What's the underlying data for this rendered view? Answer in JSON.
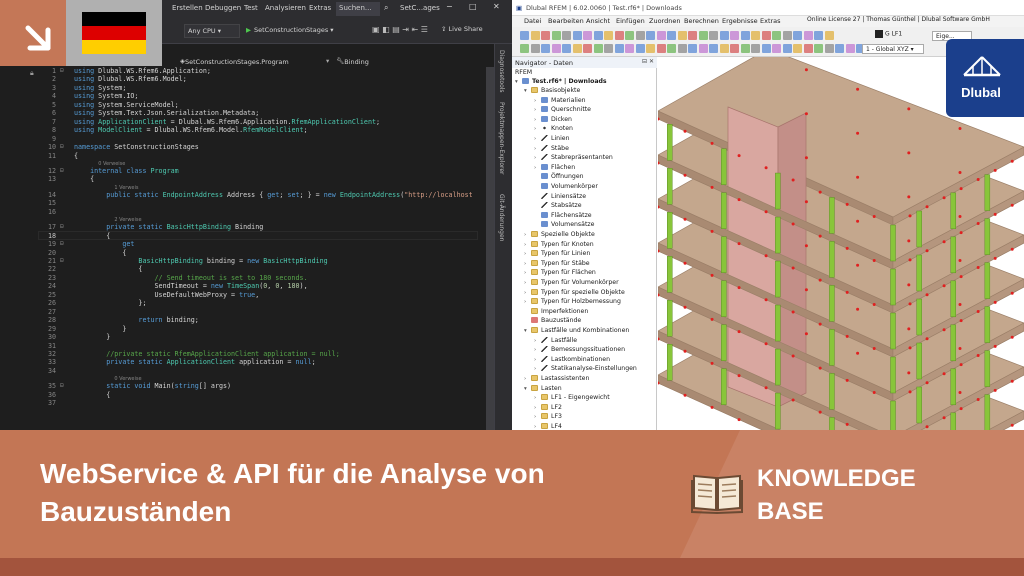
{
  "vs": {
    "menu": [
      "Erstellen",
      "Debuggen",
      "Test",
      "Analysieren",
      "Extras"
    ],
    "search": "Suchen...",
    "solution": "SetC...ages",
    "toolbar": {
      "config": "",
      "platform": "Any CPU",
      "run_target": "SetConstructionStages",
      "live_share": "Live Share"
    },
    "nav": {
      "type": "SetConstructionStages.Program",
      "member": "Binding"
    },
    "side_tabs": [
      "Diagnosetools",
      "Projektmappen-Explorer",
      "Git-Änderungen"
    ],
    "code_lines": [
      {
        "n": "1",
        "tokens": [
          [
            "k",
            "using "
          ],
          [
            "",
            "Dlubal.WS.Rfem6.Application;"
          ]
        ]
      },
      {
        "n": "2",
        "tokens": [
          [
            "k",
            "using "
          ],
          [
            "",
            "Dlubal.WS.Rfem6.Model;"
          ]
        ]
      },
      {
        "n": "3",
        "tokens": [
          [
            "k",
            "using "
          ],
          [
            "",
            "System;"
          ]
        ]
      },
      {
        "n": "4",
        "tokens": [
          [
            "k",
            "using "
          ],
          [
            "",
            "System.IO;"
          ]
        ]
      },
      {
        "n": "5",
        "tokens": [
          [
            "k",
            "using "
          ],
          [
            "",
            "System.ServiceModel;"
          ]
        ]
      },
      {
        "n": "6",
        "tokens": [
          [
            "k",
            "using "
          ],
          [
            "",
            "System.Text.Json.Serialization.Metadata;"
          ]
        ]
      },
      {
        "n": "7",
        "tokens": [
          [
            "k",
            "using "
          ],
          [
            "t",
            "ApplicationClient"
          ],
          [
            "",
            " = Dlubal.WS.Rfem6.Application."
          ],
          [
            "t",
            "RfemApplicationClient"
          ],
          [
            "",
            ";"
          ]
        ]
      },
      {
        "n": "8",
        "tokens": [
          [
            "k",
            "using "
          ],
          [
            "t",
            "ModelClient"
          ],
          [
            "",
            " = Dlubal.WS.Rfem6.Model."
          ],
          [
            "t",
            "RfemModelClient"
          ],
          [
            "",
            ";"
          ]
        ]
      },
      {
        "n": "9",
        "tokens": []
      },
      {
        "n": "10",
        "tokens": [
          [
            "k",
            "namespace "
          ],
          [
            "",
            "SetConstructionStages"
          ]
        ]
      },
      {
        "n": "11",
        "tokens": [
          [
            "",
            "{"
          ]
        ]
      },
      {
        "n": "12",
        "tokens": [
          [
            "k",
            "    internal class "
          ],
          [
            "t",
            "Program"
          ]
        ]
      },
      {
        "n": "13",
        "tokens": [
          [
            "",
            "    {"
          ]
        ]
      },
      {
        "n": "14",
        "tokens": [
          [
            "k",
            "        public static "
          ],
          [
            "t",
            "EndpointAddress"
          ],
          [
            "",
            " Address { "
          ],
          [
            "k",
            "get"
          ],
          [
            "",
            "; "
          ],
          [
            "k",
            "set"
          ],
          [
            "",
            "; } = "
          ],
          [
            "k",
            "new "
          ],
          [
            "t",
            "EndpointAddress"
          ],
          [
            "",
            "("
          ],
          [
            "s",
            "\"http://localhost"
          ]
        ]
      },
      {
        "n": "15",
        "tokens": []
      },
      {
        "n": "16",
        "tokens": []
      },
      {
        "n": "17",
        "tokens": [
          [
            "k",
            "        private static "
          ],
          [
            "t",
            "BasicHttpBinding"
          ],
          [
            "",
            " Binding"
          ]
        ]
      },
      {
        "n": "18",
        "tokens": [
          [
            "",
            "        {"
          ]
        ]
      },
      {
        "n": "19",
        "tokens": [
          [
            "k",
            "            get"
          ]
        ]
      },
      {
        "n": "20",
        "tokens": [
          [
            "",
            "            {"
          ]
        ]
      },
      {
        "n": "21",
        "tokens": [
          [
            "t",
            "                BasicHttpBinding"
          ],
          [
            "",
            " binding = "
          ],
          [
            "k",
            "new "
          ],
          [
            "t",
            "BasicHttpBinding"
          ]
        ]
      },
      {
        "n": "22",
        "tokens": [
          [
            "",
            "                {"
          ]
        ]
      },
      {
        "n": "23",
        "tokens": [
          [
            "c",
            "                    // Send timeout is set to 180 seconds."
          ]
        ]
      },
      {
        "n": "24",
        "tokens": [
          [
            "",
            "                    SendTimeout = "
          ],
          [
            "k",
            "new "
          ],
          [
            "t",
            "TimeSpan"
          ],
          [
            "",
            "("
          ],
          [
            "n",
            "0"
          ],
          [
            "",
            ", "
          ],
          [
            "n",
            "0"
          ],
          [
            "",
            ", "
          ],
          [
            "n",
            "180"
          ],
          [
            "",
            "),"
          ]
        ]
      },
      {
        "n": "25",
        "tokens": [
          [
            "",
            "                    UseDefaultWebProxy = "
          ],
          [
            "k",
            "true"
          ],
          [
            "",
            ","
          ]
        ]
      },
      {
        "n": "26",
        "tokens": [
          [
            "",
            "                };"
          ]
        ]
      },
      {
        "n": "27",
        "tokens": []
      },
      {
        "n": "28",
        "tokens": [
          [
            "k",
            "                return "
          ],
          [
            "",
            "binding;"
          ]
        ]
      },
      {
        "n": "29",
        "tokens": [
          [
            "",
            "            }"
          ]
        ]
      },
      {
        "n": "30",
        "tokens": [
          [
            "",
            "        }"
          ]
        ]
      },
      {
        "n": "31",
        "tokens": []
      },
      {
        "n": "32",
        "tokens": [
          [
            "c",
            "        //private static RfemApplicationClient application = null;"
          ]
        ]
      },
      {
        "n": "33",
        "tokens": [
          [
            "k",
            "        private static "
          ],
          [
            "t",
            "ApplicationClient"
          ],
          [
            "",
            " application = "
          ],
          [
            "k",
            "null"
          ],
          [
            "",
            ";"
          ]
        ]
      },
      {
        "n": "34",
        "tokens": []
      },
      {
        "n": "35",
        "tokens": [
          [
            "k",
            "        static void "
          ],
          [
            "",
            "Main("
          ],
          [
            "k",
            "string"
          ],
          [
            "",
            "[] args)"
          ]
        ]
      },
      {
        "n": "36",
        "tokens": [
          [
            "",
            "        {"
          ]
        ]
      },
      {
        "n": "37",
        "tokens": []
      }
    ],
    "hints": [
      {
        "before": "12",
        "text": "0 Verweise"
      },
      {
        "before": "14",
        "text": "1 Verweis"
      },
      {
        "before": "17",
        "text": "2 Verweise"
      },
      {
        "before": "35",
        "text": "0 Verweise"
      }
    ]
  },
  "rfem": {
    "title": "Dlubal RFEM | 6.02.0060 | Test.rf6* | Downloads",
    "menu": [
      "Datei",
      "Bearbeiten",
      "Ansicht",
      "Einfügen",
      "Zuordnen",
      "Berechnen",
      "Ergebnisse",
      "Extras"
    ],
    "license": "Online License 27 | Thomas Günthel | Dlubal Software GmbH",
    "load_case": "G",
    "load_case_id": "LF1",
    "eigen": "Eige...",
    "view": "1 - Global XYZ",
    "navigator": {
      "header": "Navigator - Daten",
      "root": "RFEM",
      "file": "Test.rf6* | Downloads",
      "items": [
        {
          "level": 1,
          "arrow": "down",
          "icon": "fold-i",
          "label": "Basisobjekte"
        },
        {
          "level": 2,
          "arrow": "right",
          "icon": "blue",
          "label": "Materialien"
        },
        {
          "level": 2,
          "arrow": "right",
          "icon": "blue",
          "label": "Querschnitte"
        },
        {
          "level": 2,
          "arrow": "right",
          "icon": "blue",
          "label": "Dicken"
        },
        {
          "level": 2,
          "arrow": "right",
          "icon": "dot",
          "label": "Knoten"
        },
        {
          "level": 2,
          "arrow": "right",
          "icon": "line",
          "label": "Linien"
        },
        {
          "level": 2,
          "arrow": "right",
          "icon": "line",
          "label": "Stäbe"
        },
        {
          "level": 2,
          "arrow": "right",
          "icon": "line",
          "label": "Stabrepräsentanten"
        },
        {
          "level": 2,
          "arrow": "right",
          "icon": "blue",
          "label": "Flächen"
        },
        {
          "level": 2,
          "arrow": "",
          "icon": "blue",
          "label": "Öffnungen"
        },
        {
          "level": 2,
          "arrow": "",
          "icon": "blue",
          "label": "Volumenkörper"
        },
        {
          "level": 2,
          "arrow": "",
          "icon": "line",
          "label": "Liniensätze"
        },
        {
          "level": 2,
          "arrow": "",
          "icon": "line",
          "label": "Stabsätze"
        },
        {
          "level": 2,
          "arrow": "",
          "icon": "blue",
          "label": "Flächensätze"
        },
        {
          "level": 2,
          "arrow": "",
          "icon": "blue",
          "label": "Volumensätze"
        },
        {
          "level": 1,
          "arrow": "right",
          "icon": "fold-i",
          "label": "Spezielle Objekte"
        },
        {
          "level": 1,
          "arrow": "right",
          "icon": "fold-i",
          "label": "Typen für Knoten"
        },
        {
          "level": 1,
          "arrow": "right",
          "icon": "fold-i",
          "label": "Typen für Linien"
        },
        {
          "level": 1,
          "arrow": "right",
          "icon": "fold-i",
          "label": "Typen für Stäbe"
        },
        {
          "level": 1,
          "arrow": "right",
          "icon": "fold-i",
          "label": "Typen für Flächen"
        },
        {
          "level": 1,
          "arrow": "right",
          "icon": "fold-i",
          "label": "Typen für Volumenkörper"
        },
        {
          "level": 1,
          "arrow": "right",
          "icon": "fold-i",
          "label": "Typen für spezielle Objekte"
        },
        {
          "level": 1,
          "arrow": "right",
          "icon": "fold-i",
          "label": "Typen für Holzbemessung"
        },
        {
          "level": 1,
          "arrow": "",
          "icon": "fold-i",
          "label": "Imperfektionen"
        },
        {
          "level": 1,
          "arrow": "",
          "icon": "pink",
          "label": "Bauzustände"
        },
        {
          "level": 1,
          "arrow": "down",
          "icon": "fold-i",
          "label": "Lastfälle und Kombinationen"
        },
        {
          "level": 2,
          "arrow": "right",
          "icon": "line",
          "label": "Lastfälle"
        },
        {
          "level": 2,
          "arrow": "right",
          "icon": "line",
          "label": "Bemessungssituationen"
        },
        {
          "level": 2,
          "arrow": "right",
          "icon": "line",
          "label": "Lastkombinationen"
        },
        {
          "level": 2,
          "arrow": "right",
          "icon": "line",
          "label": "Statikanalyse-Einstellungen"
        },
        {
          "level": 1,
          "arrow": "right",
          "icon": "fold-i",
          "label": "Lastassistenten"
        },
        {
          "level": 1,
          "arrow": "down",
          "icon": "fold-i",
          "label": "Lasten"
        },
        {
          "level": 2,
          "arrow": "right",
          "icon": "fold-i",
          "label": "LF1 - Eigengewicht"
        },
        {
          "level": 2,
          "arrow": "right",
          "icon": "fold-i",
          "label": "LF2"
        },
        {
          "level": 2,
          "arrow": "right",
          "icon": "fold-i",
          "label": "LF3"
        },
        {
          "level": 2,
          "arrow": "right",
          "icon": "fold-i",
          "label": "LF4"
        }
      ]
    },
    "model": {
      "slab_color": "#c4a78d",
      "slab_edge": "#9b7f68",
      "wall_color": "#d9a7a0",
      "wall_edge": "#a7746c",
      "column_color": "#88c53a",
      "node_color": "#e02020",
      "floors": 7
    }
  },
  "brand": {
    "name": "Dlubal",
    "color": "#1b3f8c"
  },
  "flag": {
    "country": "Germany",
    "colors": [
      "#000000",
      "#dd0000",
      "#ffce00"
    ]
  },
  "banner": {
    "title": "WebService & API für die Analyse von Bauzuständen",
    "category": "KNOWLEDGE BASE",
    "bg_color": "#c37655",
    "accent_color": "#a3543d",
    "icon": "open-book-icon"
  }
}
